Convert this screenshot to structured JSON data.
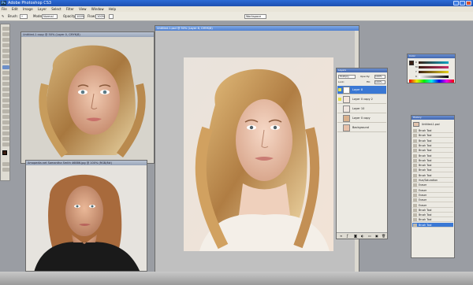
{
  "app": {
    "title": "Adobe Photoshop CS3"
  },
  "menu": [
    "File",
    "Edit",
    "Image",
    "Layer",
    "Select",
    "Filter",
    "View",
    "Window",
    "Help"
  ],
  "options": {
    "brush_label": "Brush:",
    "mode_label": "Mode:",
    "mode_value": "Normal",
    "opacity_label": "Opacity:",
    "opacity_value": "100%",
    "flow_label": "Flow:",
    "flow_value": "100%",
    "workspace_label": "Workspace"
  },
  "documents": [
    {
      "title": "Untitled-1 copy @ 50% (Layer 0, CMYK/8)",
      "status": ""
    },
    {
      "title": "Amopedia.net Samantha Smith 46886.jpg @ 100% (RGB/8#)",
      "status": ""
    },
    {
      "title": "Untitled-1.psd @ 50% (Layer 8, CMYK/8)",
      "status_zoom": "50%",
      "status_doc": "Doc: 7.47M/60.0M"
    }
  ],
  "color_panel": {
    "title": "Color",
    "channels": [
      "C",
      "M",
      "Y",
      "K"
    ]
  },
  "layers_panel": {
    "title": "Layers",
    "blend_mode": "Multiply",
    "opacity_label": "Opacity:",
    "opacity_value": "100%",
    "lock_label": "Lock:",
    "fill_label": "Fill:",
    "fill_value": "100%",
    "layers": [
      {
        "name": "Layer 8",
        "selected": true,
        "visible": true
      },
      {
        "name": "Layer 0 copy 2",
        "selected": false,
        "visible": true
      },
      {
        "name": "Layer 10",
        "selected": false,
        "visible": false
      },
      {
        "name": "Layer 0 copy",
        "selected": false,
        "visible": false
      },
      {
        "name": "Background",
        "selected": false,
        "visible": false
      }
    ]
  },
  "history_panel": {
    "title": "History",
    "snapshot": "Untitled-1.psd",
    "steps": [
      "Brush Tool",
      "Brush Tool",
      "Brush Tool",
      "Brush Tool",
      "Brush Tool",
      "Brush Tool",
      "Brush Tool",
      "Brush Tool",
      "Brush Tool",
      "Brush Tool",
      "Hue/Saturation",
      "Eraser",
      "Eraser",
      "Eraser",
      "Eraser",
      "Eraser",
      "Brush Tool",
      "Brush Tool",
      "Brush Tool",
      "Brush Tool"
    ],
    "active_index": 19
  },
  "colors": {
    "accent": "#3a78d4",
    "titlebar": "#1d4fb0",
    "workspace": "#9a9da3"
  }
}
